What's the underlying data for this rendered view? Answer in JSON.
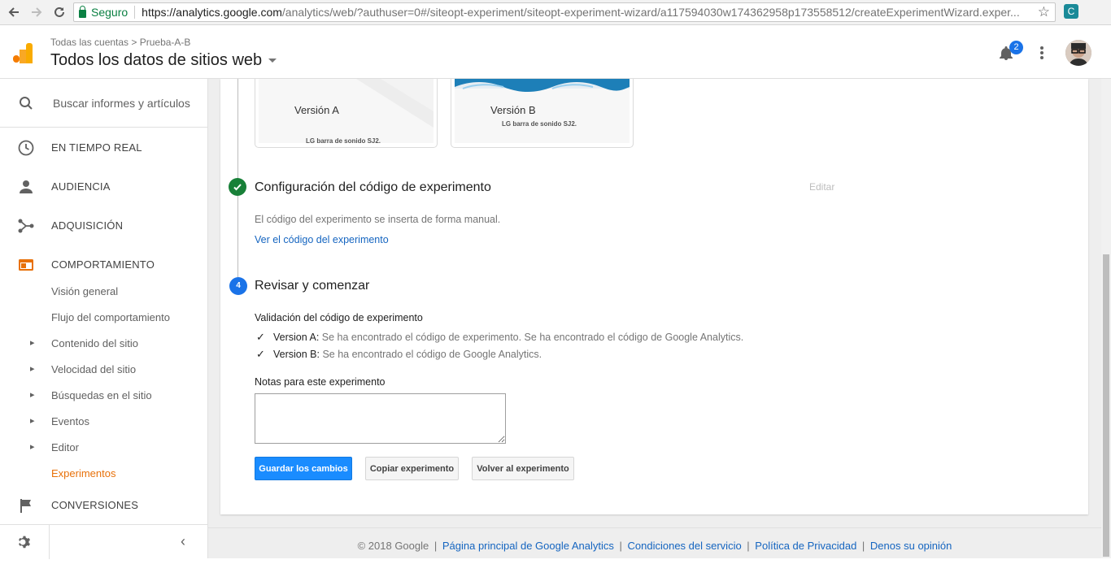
{
  "browser": {
    "secure_label": "Seguro",
    "url_domain": "https://analytics.google.com",
    "url_path": "/analytics/web/?authuser=0#/siteopt-experiment/siteopt-experiment-wizard/a117594030w174362958p173558512/createExperimentWizard.exper..."
  },
  "header": {
    "breadcrumb": "Todas las cuentas  >  Prueba-A-B",
    "property": "Todos los datos de sitios web",
    "notification_count": "2"
  },
  "sidebar": {
    "search_placeholder": "Buscar informes y artículos",
    "items": [
      {
        "label": "EN TIEMPO REAL",
        "icon": "clock-icon"
      },
      {
        "label": "AUDIENCIA",
        "icon": "person-icon"
      },
      {
        "label": "ADQUISICIÓN",
        "icon": "acquisition-icon"
      },
      {
        "label": "COMPORTAMIENTO",
        "icon": "behavior-icon"
      }
    ],
    "sub_items": [
      {
        "label": "Visión general"
      },
      {
        "label": "Flujo del comportamiento"
      },
      {
        "label": "Contenido del sitio"
      },
      {
        "label": "Velocidad del sitio"
      },
      {
        "label": "Búsquedas en el sitio"
      },
      {
        "label": "Eventos"
      },
      {
        "label": "Editor"
      },
      {
        "label": "Experimentos"
      }
    ],
    "conversions": "CONVERSIONES"
  },
  "variants": [
    {
      "title": "Versión A",
      "subtitle": "LG barra de sonido SJ2."
    },
    {
      "title": "Versión B",
      "subtitle": "LG barra de sonido SJ2."
    }
  ],
  "step3": {
    "title": "Configuración del código de experimento",
    "edit": "Editar",
    "description": "El código del experimento se inserta de forma manual.",
    "link": "Ver el código del experimento"
  },
  "step4": {
    "number": "4",
    "title": "Revisar y comenzar",
    "validation_heading": "Validación del código de experimento",
    "checks": [
      {
        "name": "Version A:",
        "message": "Se ha encontrado el código de experimento. Se ha encontrado el código de Google Analytics."
      },
      {
        "name": "Version B:",
        "message": "Se ha encontrado el código de Google Analytics."
      }
    ],
    "notes_label": "Notas para este experimento",
    "notes_value": "",
    "buttons": {
      "save": "Guardar los cambios",
      "copy": "Copiar experimento",
      "back": "Volver al experimento"
    }
  },
  "footer": {
    "copyright": "© 2018 Google",
    "links": [
      "Página principal de Google Analytics",
      "Condiciones del servicio",
      "Política de Privacidad",
      "Denos su opinión"
    ]
  },
  "colors": {
    "accent": "#1a8cff",
    "success": "#188038",
    "active_nav": "#e8710a"
  }
}
